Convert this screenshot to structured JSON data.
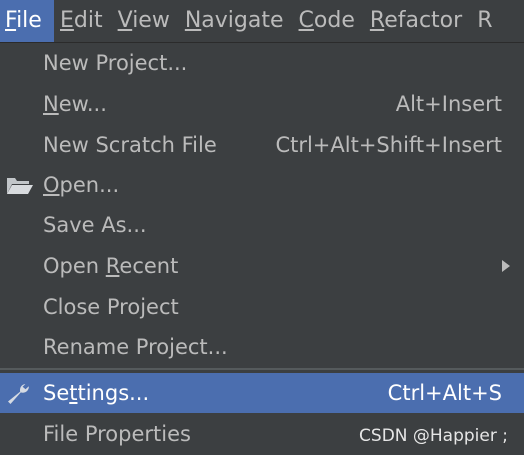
{
  "menubar": {
    "items": [
      {
        "mnemonic": "F",
        "rest": "ile"
      },
      {
        "mnemonic": "E",
        "rest": "dit"
      },
      {
        "mnemonic": "V",
        "rest": "iew"
      },
      {
        "mnemonic": "N",
        "rest": "avigate"
      },
      {
        "mnemonic": "C",
        "rest": "ode"
      },
      {
        "mnemonic": "R",
        "rest": "efactor"
      },
      {
        "mnemonic": "",
        "rest": "R"
      }
    ]
  },
  "file_menu": {
    "new_project": "New Project...",
    "new": {
      "mnemonic": "N",
      "rest": "ew...",
      "shortcut": "Alt+Insert"
    },
    "new_scratch": {
      "label": "New Scratch File",
      "shortcut": "Ctrl+Alt+Shift+Insert"
    },
    "open": {
      "mnemonic": "O",
      "rest": "pen...",
      "icon": "folder-open-icon"
    },
    "save_as": "Save As...",
    "open_recent": {
      "before": "Open ",
      "mnemonic": "R",
      "rest": "ecent"
    },
    "close_project": "Close Project",
    "rename_project": "Rename Project...",
    "settings": {
      "before": "Se",
      "mnemonic": "t",
      "rest": "tings...",
      "shortcut": "Ctrl+Alt+S",
      "icon": "wrench-icon"
    },
    "file_properties": "File Properties"
  },
  "watermark": "CSDN @Happier ;",
  "colors": {
    "background": "#3c3f41",
    "selection": "#4b6eaf",
    "text": "#bbbbbb"
  }
}
